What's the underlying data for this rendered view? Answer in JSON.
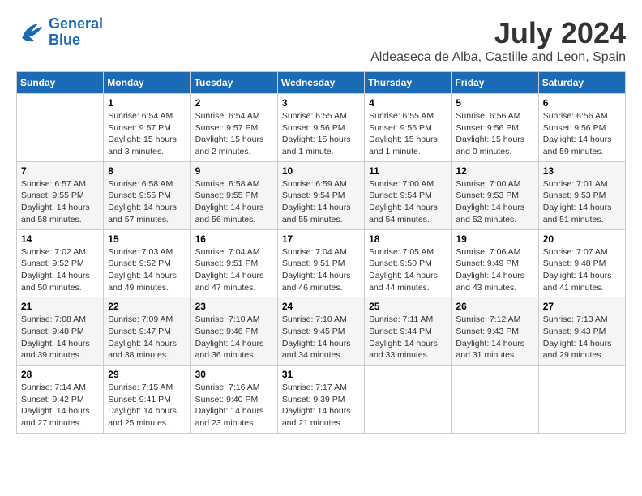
{
  "header": {
    "logo_line1": "General",
    "logo_line2": "Blue",
    "month_year": "July 2024",
    "location": "Aldeaseca de Alba, Castille and Leon, Spain"
  },
  "weekdays": [
    "Sunday",
    "Monday",
    "Tuesday",
    "Wednesday",
    "Thursday",
    "Friday",
    "Saturday"
  ],
  "weeks": [
    [
      null,
      {
        "day": "1",
        "sunrise": "6:54 AM",
        "sunset": "9:57 PM",
        "daylight": "15 hours and 3 minutes."
      },
      {
        "day": "2",
        "sunrise": "6:54 AM",
        "sunset": "9:57 PM",
        "daylight": "15 hours and 2 minutes."
      },
      {
        "day": "3",
        "sunrise": "6:55 AM",
        "sunset": "9:56 PM",
        "daylight": "15 hours and 1 minute."
      },
      {
        "day": "4",
        "sunrise": "6:55 AM",
        "sunset": "9:56 PM",
        "daylight": "15 hours and 1 minute."
      },
      {
        "day": "5",
        "sunrise": "6:56 AM",
        "sunset": "9:56 PM",
        "daylight": "15 hours and 0 minutes."
      },
      {
        "day": "6",
        "sunrise": "6:56 AM",
        "sunset": "9:56 PM",
        "daylight": "14 hours and 59 minutes."
      }
    ],
    [
      {
        "day": "7",
        "sunrise": "6:57 AM",
        "sunset": "9:55 PM",
        "daylight": "14 hours and 58 minutes."
      },
      {
        "day": "8",
        "sunrise": "6:58 AM",
        "sunset": "9:55 PM",
        "daylight": "14 hours and 57 minutes."
      },
      {
        "day": "9",
        "sunrise": "6:58 AM",
        "sunset": "9:55 PM",
        "daylight": "14 hours and 56 minutes."
      },
      {
        "day": "10",
        "sunrise": "6:59 AM",
        "sunset": "9:54 PM",
        "daylight": "14 hours and 55 minutes."
      },
      {
        "day": "11",
        "sunrise": "7:00 AM",
        "sunset": "9:54 PM",
        "daylight": "14 hours and 54 minutes."
      },
      {
        "day": "12",
        "sunrise": "7:00 AM",
        "sunset": "9:53 PM",
        "daylight": "14 hours and 52 minutes."
      },
      {
        "day": "13",
        "sunrise": "7:01 AM",
        "sunset": "9:53 PM",
        "daylight": "14 hours and 51 minutes."
      }
    ],
    [
      {
        "day": "14",
        "sunrise": "7:02 AM",
        "sunset": "9:52 PM",
        "daylight": "14 hours and 50 minutes."
      },
      {
        "day": "15",
        "sunrise": "7:03 AM",
        "sunset": "9:52 PM",
        "daylight": "14 hours and 49 minutes."
      },
      {
        "day": "16",
        "sunrise": "7:04 AM",
        "sunset": "9:51 PM",
        "daylight": "14 hours and 47 minutes."
      },
      {
        "day": "17",
        "sunrise": "7:04 AM",
        "sunset": "9:51 PM",
        "daylight": "14 hours and 46 minutes."
      },
      {
        "day": "18",
        "sunrise": "7:05 AM",
        "sunset": "9:50 PM",
        "daylight": "14 hours and 44 minutes."
      },
      {
        "day": "19",
        "sunrise": "7:06 AM",
        "sunset": "9:49 PM",
        "daylight": "14 hours and 43 minutes."
      },
      {
        "day": "20",
        "sunrise": "7:07 AM",
        "sunset": "9:48 PM",
        "daylight": "14 hours and 41 minutes."
      }
    ],
    [
      {
        "day": "21",
        "sunrise": "7:08 AM",
        "sunset": "9:48 PM",
        "daylight": "14 hours and 39 minutes."
      },
      {
        "day": "22",
        "sunrise": "7:09 AM",
        "sunset": "9:47 PM",
        "daylight": "14 hours and 38 minutes."
      },
      {
        "day": "23",
        "sunrise": "7:10 AM",
        "sunset": "9:46 PM",
        "daylight": "14 hours and 36 minutes."
      },
      {
        "day": "24",
        "sunrise": "7:10 AM",
        "sunset": "9:45 PM",
        "daylight": "14 hours and 34 minutes."
      },
      {
        "day": "25",
        "sunrise": "7:11 AM",
        "sunset": "9:44 PM",
        "daylight": "14 hours and 33 minutes."
      },
      {
        "day": "26",
        "sunrise": "7:12 AM",
        "sunset": "9:43 PM",
        "daylight": "14 hours and 31 minutes."
      },
      {
        "day": "27",
        "sunrise": "7:13 AM",
        "sunset": "9:43 PM",
        "daylight": "14 hours and 29 minutes."
      }
    ],
    [
      {
        "day": "28",
        "sunrise": "7:14 AM",
        "sunset": "9:42 PM",
        "daylight": "14 hours and 27 minutes."
      },
      {
        "day": "29",
        "sunrise": "7:15 AM",
        "sunset": "9:41 PM",
        "daylight": "14 hours and 25 minutes."
      },
      {
        "day": "30",
        "sunrise": "7:16 AM",
        "sunset": "9:40 PM",
        "daylight": "14 hours and 23 minutes."
      },
      {
        "day": "31",
        "sunrise": "7:17 AM",
        "sunset": "9:39 PM",
        "daylight": "14 hours and 21 minutes."
      },
      null,
      null,
      null
    ]
  ]
}
